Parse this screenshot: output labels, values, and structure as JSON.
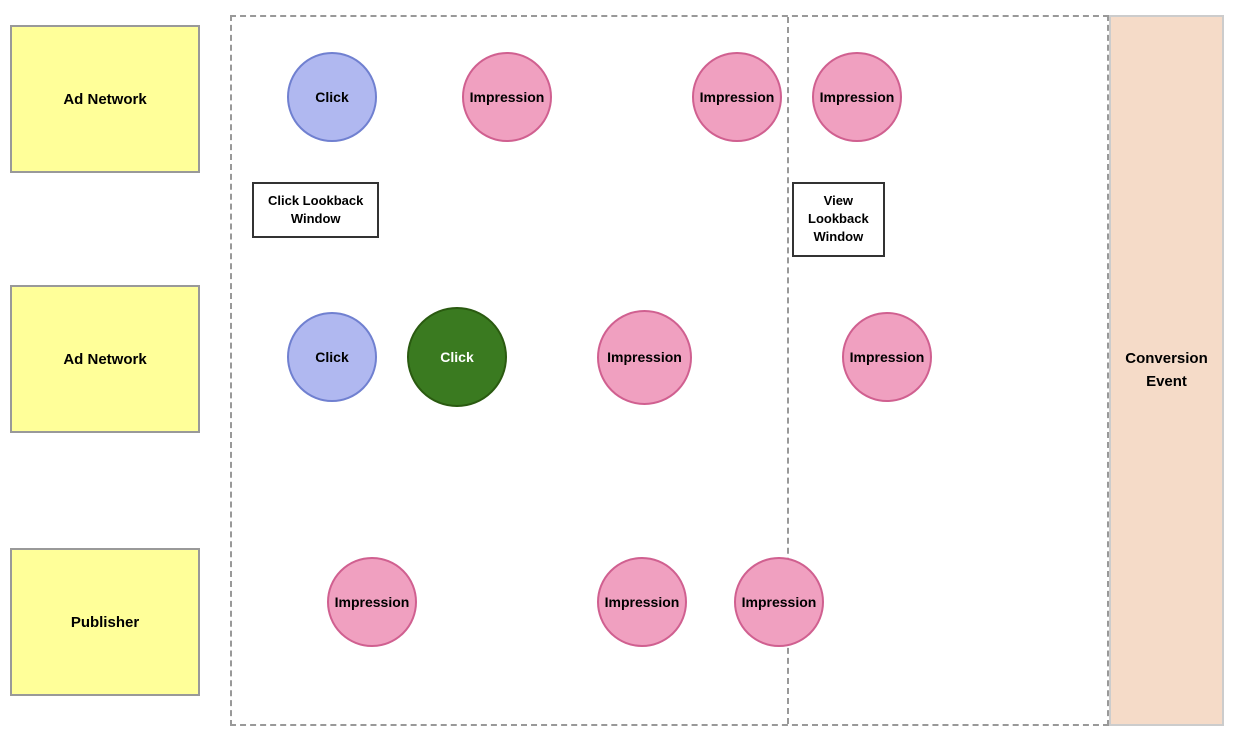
{
  "entities": {
    "ad_network_1": "Ad Network",
    "ad_network_2": "Ad Network",
    "publisher": "Publisher"
  },
  "sidebar": {
    "conversion_event": "Conversion\nEvent"
  },
  "lookback_boxes": {
    "click": "Click Lookback\nWindow",
    "view": "View\nLookback\nWindow"
  },
  "circles": {
    "click_label": "Click",
    "impression_label": "Impression"
  }
}
